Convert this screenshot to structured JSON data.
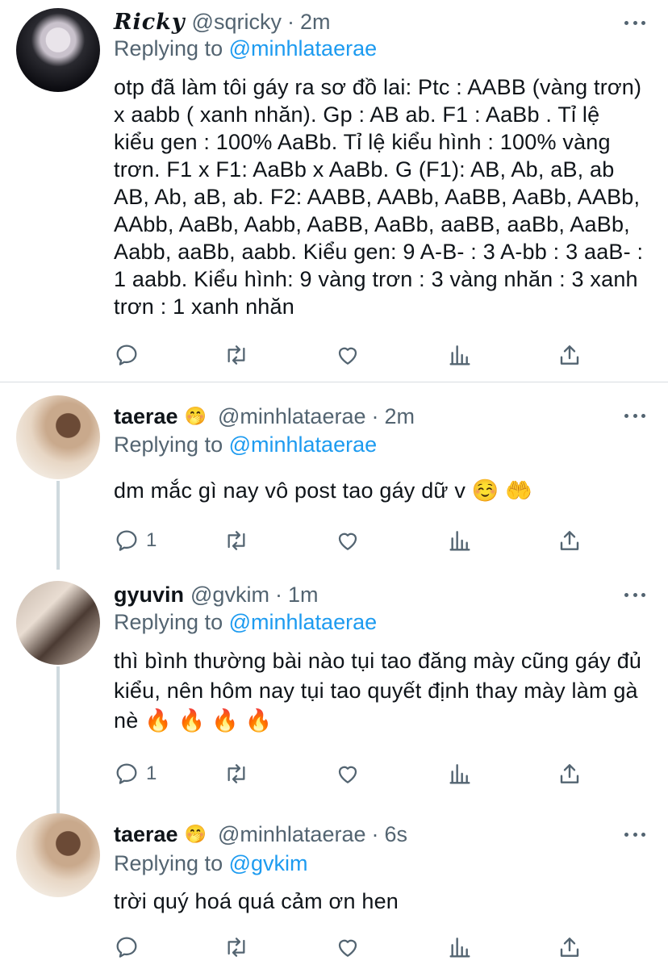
{
  "tweets": [
    {
      "name": "Ricky",
      "handle": "@sqricky",
      "time": "2m",
      "replying_prefix": "Replying to",
      "replying_to": "@minhlataerae",
      "text": "otp đã làm tôi gáy ra sơ đồ lai: Ptc : AABB (vàng trơn) x aabb ( xanh nhăn). Gp : AB ab. F1 : AaBb . Tỉ lệ kiểu gen : 100% AaBb. Tỉ lệ kiểu hình : 100% vàng trơn. F1 x F1: AaBb x AaBb. G (F1): AB, Ab, aB, ab AB, Ab, aB, ab. F2: AABB, AABb, AaBB, AaBb, AABb, AAbb, AaBb, Aabb, AaBB, AaBb, aaBB, aaBb, AaBb, Aabb, aaBb, aabb. Kiểu gen: 9 A-B- : 3 A-bb : 3 aaB- : 1 aabb. Kiểu hình: 9 vàng trơn : 3 vàng nhăn : 3 xanh trơn : 1 xanh nhăn",
      "reply_count": "",
      "name_emoji": ""
    },
    {
      "name": "taerae",
      "name_emoji": "🤭",
      "handle": "@minhlataerae",
      "time": "2m",
      "replying_prefix": "Replying to",
      "replying_to": "@minhlataerae",
      "text": "dm mắc gì nay vô post tao gáy dữ v ☺️ 🤲",
      "reply_count": "1"
    },
    {
      "name": "gyuvin",
      "name_emoji": "",
      "handle": "@gvkim",
      "time": "1m",
      "replying_prefix": "Replying to",
      "replying_to": "@minhlataerae",
      "text": "thì bình thường bài nào tụi tao đăng mày cũng gáy đủ kiểu, nên hôm nay tụi tao quyết định thay mày làm gà nè 🔥 🔥 🔥 🔥",
      "reply_count": "1"
    },
    {
      "name": "taerae",
      "name_emoji": "🤭",
      "handle": "@minhlataerae",
      "time": "6s",
      "replying_prefix": "Replying to",
      "replying_to": "@gvkim",
      "text": "trời quý hoá quá cảm ơn hen",
      "reply_count": ""
    }
  ],
  "separator": "·",
  "icons": {
    "reply": "reply-icon",
    "retweet": "retweet-icon",
    "like": "heart-icon",
    "analytics": "analytics-icon",
    "share": "share-icon",
    "more": "more-icon"
  },
  "colors": {
    "link": "#1d9bf0",
    "secondary_text": "#536471",
    "thread_line": "#cfd9de"
  }
}
